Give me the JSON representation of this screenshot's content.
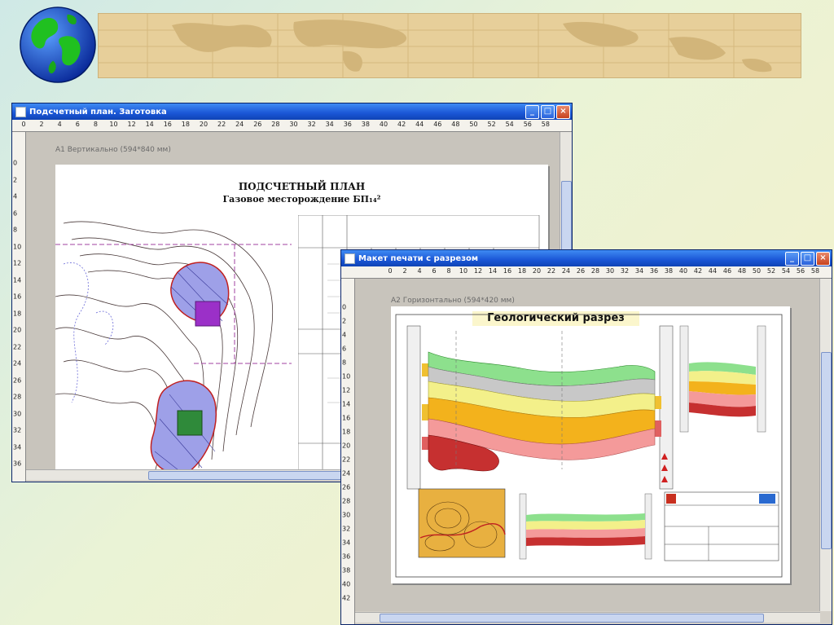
{
  "window_plan": {
    "title": "Подсчетный план. Заготовка",
    "ruler_top": [
      "0",
      "2",
      "4",
      "6",
      "8",
      "10",
      "12",
      "14",
      "16",
      "18",
      "20",
      "22",
      "24",
      "26",
      "28",
      "30",
      "32",
      "34",
      "36",
      "38",
      "40",
      "42",
      "44",
      "46",
      "48",
      "50",
      "52",
      "54",
      "56",
      "58"
    ],
    "ruler_left": [
      "0",
      "2",
      "4",
      "6",
      "8",
      "10",
      "12",
      "14",
      "16",
      "18",
      "20",
      "22",
      "24",
      "26",
      "28",
      "30",
      "32",
      "34",
      "36"
    ],
    "sheet_label": "А1 Вертикально (594*840 мм)",
    "plan_title": "ПОДСЧЕТНЫЙ ПЛАН",
    "plan_subtitle": "Газовое месторождение БП₁₄²"
  },
  "window_section": {
    "title": "Макет печати с разрезом",
    "ruler_top": [
      "0",
      "2",
      "4",
      "6",
      "8",
      "10",
      "12",
      "14",
      "16",
      "18",
      "20",
      "22",
      "24",
      "26",
      "28",
      "30",
      "32",
      "34",
      "36",
      "38",
      "40",
      "42",
      "44",
      "46",
      "48",
      "50",
      "52",
      "54",
      "56",
      "58"
    ],
    "ruler_left": [
      "0",
      "2",
      "4",
      "6",
      "8",
      "10",
      "12",
      "14",
      "16",
      "18",
      "20",
      "22",
      "24",
      "26",
      "28",
      "30",
      "32",
      "34",
      "36",
      "38",
      "40",
      "42"
    ],
    "sheet_label": "А2 Горизонтально (594*420 мм)",
    "section_title": "Геологический разрез"
  },
  "window_controls": {
    "minimize": "_",
    "maximize": "□",
    "close": "×"
  },
  "colors": {
    "titlebar": "#1a56d6",
    "banner": "#e7cf9a",
    "workspace": "#c8c4bc"
  }
}
